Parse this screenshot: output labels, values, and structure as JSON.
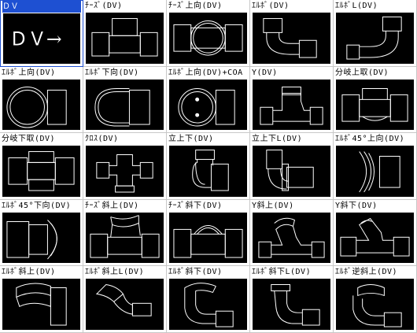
{
  "palette": {
    "background": "#000000",
    "stroke": "#ffffff",
    "selection": "#1e50d2"
  },
  "items": [
    {
      "label": "ＤＶ",
      "icon": "dv-arrow-icon",
      "selected": true,
      "thumb_text": "ＤＶ→"
    },
    {
      "label": "ﾁｰｽﾞ(DV)",
      "icon": "cheese-tee-icon"
    },
    {
      "label": "ﾁｰｽﾞ上向(DV)",
      "icon": "cheese-up-icon"
    },
    {
      "label": "ｴﾙﾎﾞ(DV)",
      "icon": "elbow-icon"
    },
    {
      "label": "ｴﾙﾎﾞL(DV)",
      "icon": "elbow-long-icon"
    },
    {
      "label": "ｴﾙﾎﾞ上向(DV)",
      "icon": "elbow-up-icon"
    },
    {
      "label": "ｴﾙﾎﾞ下向(DV)",
      "icon": "elbow-down-icon"
    },
    {
      "label": "ｴﾙﾎﾞ上向(DV)+COA",
      "icon": "elbow-up-coa-icon"
    },
    {
      "label": "Y(DV)",
      "icon": "y-branch-icon"
    },
    {
      "label": "分岐上取(DV)",
      "icon": "branch-top-icon"
    },
    {
      "label": "分岐下取(DV)",
      "icon": "branch-bottom-icon"
    },
    {
      "label": "ｸﾛｽ(DV)",
      "icon": "cross-icon"
    },
    {
      "label": "立上下(DV)",
      "icon": "riser-icon"
    },
    {
      "label": "立上下L(DV)",
      "icon": "riser-long-icon"
    },
    {
      "label": "ｴﾙﾎﾞ45°上向(DV)",
      "icon": "elbow45-up-icon"
    },
    {
      "label": "ｴﾙﾎﾞ45°下向(DV)",
      "icon": "elbow45-down-icon"
    },
    {
      "label": "ﾁｰｽﾞ斜上(DV)",
      "icon": "cheese-diag-up-icon"
    },
    {
      "label": "ﾁｰｽﾞ斜下(DV)",
      "icon": "cheese-diag-down-icon"
    },
    {
      "label": "Y斜上(DV)",
      "icon": "y-diag-up-icon"
    },
    {
      "label": "Y斜下(DV)",
      "icon": "y-diag-down-icon"
    },
    {
      "label": "ｴﾙﾎﾞ斜上(DV)",
      "icon": "elbow-diag-up-icon"
    },
    {
      "label": "ｴﾙﾎﾞ斜上L(DV)",
      "icon": "elbow-diag-up-long-icon"
    },
    {
      "label": "ｴﾙﾎﾞ斜下(DV)",
      "icon": "elbow-diag-down-icon"
    },
    {
      "label": "ｴﾙﾎﾞ斜下L(DV)",
      "icon": "elbow-diag-down-long-icon"
    },
    {
      "label": "ｴﾙﾎﾞ逆斜上(DV)",
      "icon": "elbow-reverse-diag-up-icon"
    }
  ]
}
